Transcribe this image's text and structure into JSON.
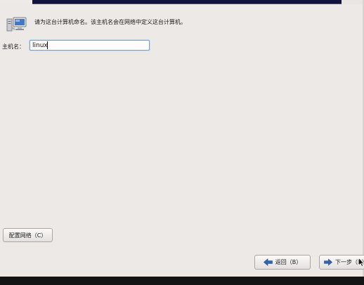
{
  "intro": {
    "text": "请为这台计算机命名。该主机名会在网络中定义这台计算机。",
    "icon": "computer-network-icon"
  },
  "hostname": {
    "label": "主机名：",
    "value": "linux"
  },
  "buttons": {
    "configure_network": "配置网络（C）",
    "back": "返回（B）",
    "next": "下一步（N）"
  },
  "colors": {
    "background": "#ede9e7",
    "banner": "#12123a",
    "input_focus_border": "#7aa5d6",
    "arrow_blue": "#2f66b3"
  }
}
